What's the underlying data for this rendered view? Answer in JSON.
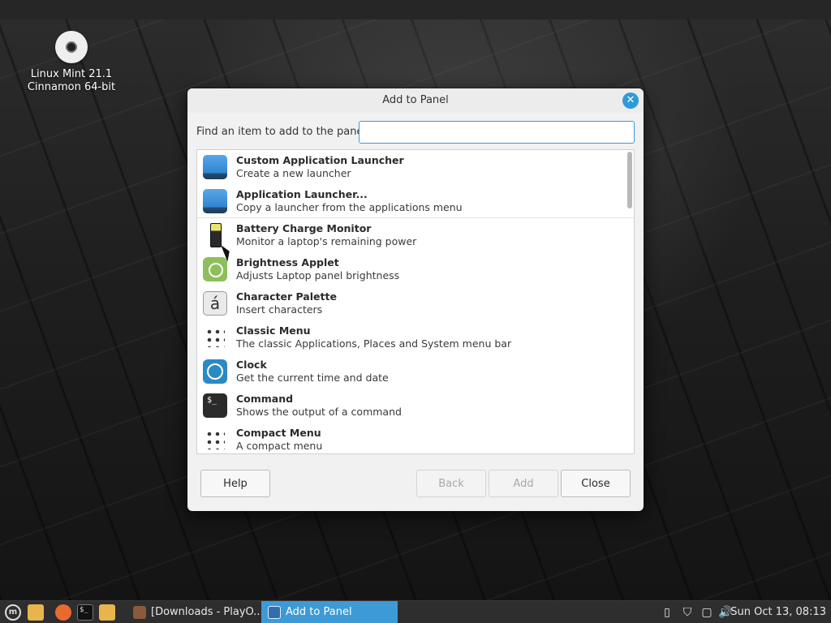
{
  "desktop": {
    "icon_label_line1": "Linux Mint 21.1",
    "icon_label_line2": "Cinnamon 64-bit",
    "icon_name": "disc-icon"
  },
  "dialog": {
    "title": "Add to Panel",
    "search_label": "Find an item to add to the panel:",
    "search_value": "",
    "search_placeholder": "",
    "items": [
      {
        "name": "Custom Application Launcher",
        "desc": "Create a new launcher",
        "icon": "launcher-icon"
      },
      {
        "name": "Application Launcher...",
        "desc": "Copy a launcher from the applications menu",
        "icon": "launcher-icon"
      },
      {
        "name": "Battery Charge Monitor",
        "desc": "Monitor a laptop's remaining power",
        "icon": "battery-icon"
      },
      {
        "name": "Brightness Applet",
        "desc": "Adjusts Laptop panel brightness",
        "icon": "brightness-icon"
      },
      {
        "name": "Character Palette",
        "desc": "Insert characters",
        "icon": "character-icon",
        "glyph": "á"
      },
      {
        "name": "Classic Menu",
        "desc": "The classic Applications, Places and System menu bar",
        "icon": "grid-menu-icon"
      },
      {
        "name": "Clock",
        "desc": "Get the current time and date",
        "icon": "clock-icon"
      },
      {
        "name": "Command",
        "desc": "Shows the output of a command",
        "icon": "terminal-icon",
        "glyph": "$_"
      },
      {
        "name": "Compact Menu",
        "desc": "A compact menu",
        "icon": "grid-menu-icon"
      }
    ],
    "buttons": {
      "help": "Help",
      "back": "Back",
      "add": "Add",
      "close": "Close"
    }
  },
  "taskbar": {
    "menu_glyph": "m",
    "terminal_glyph": "$_",
    "windows": [
      {
        "label": "[Downloads - PlayO...",
        "active": false
      },
      {
        "label": "Add to Panel",
        "active": true
      }
    ],
    "clock": "Sun Oct 13, 08:13"
  },
  "colors": {
    "accent": "#3d9ad6",
    "dialog_bg": "#f1f1f1",
    "taskbar_bg": "#2e2e2e"
  }
}
